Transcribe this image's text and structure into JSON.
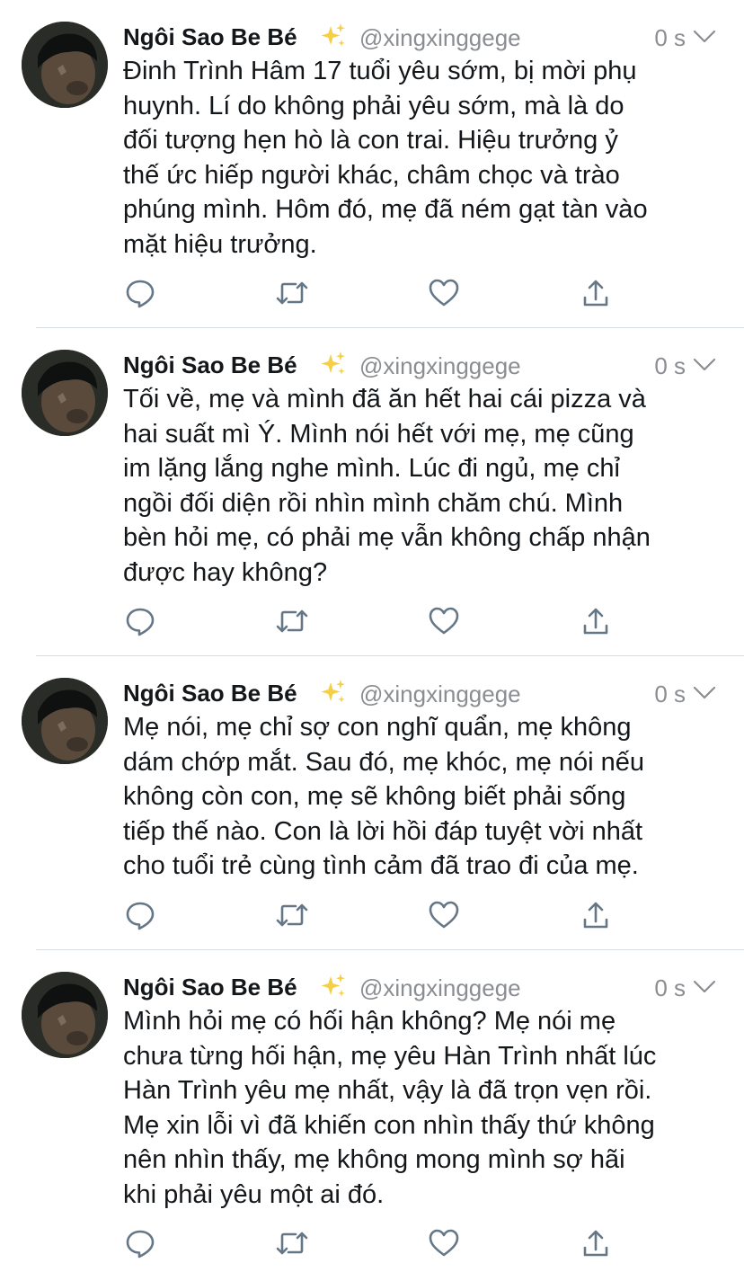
{
  "colors": {
    "text": "#14171a",
    "secondary": "#8a8d91",
    "icon": "#657786",
    "sparkle": "#f5cf45",
    "divider": "#d8dde1"
  },
  "tweets": [
    {
      "name": "Ngôi Sao Be Bé",
      "handle": "@xingxinggege",
      "time": "0 s",
      "text": "Đinh Trình Hâm 17 tuổi yêu sớm, bị mời phụ\nhuynh. Lí do không phải yêu sớm, mà là do\nđối tượng hẹn hò là con trai. Hiệu trưởng ỷ\nthế ức hiếp người khác, châm chọc và trào\nphúng mình. Hôm đó, mẹ đã ném gạt tàn vào\nmặt hiệu trưởng."
    },
    {
      "name": "Ngôi Sao Be Bé",
      "handle": "@xingxinggege",
      "time": "0 s",
      "text": "Tối về, mẹ và mình đã ăn hết hai cái pizza và\nhai suất mì Ý. Mình nói hết với mẹ, mẹ cũng\nim lặng lắng nghe mình. Lúc đi ngủ, mẹ chỉ\nngồi đối diện rồi nhìn mình chăm chú. Mình\nbèn hỏi mẹ, có phải mẹ vẫn không chấp nhận\nđược hay không?"
    },
    {
      "name": "Ngôi Sao Be Bé",
      "handle": "@xingxinggege",
      "time": "0 s",
      "text": "Mẹ nói, mẹ chỉ sợ con nghĩ quẩn, mẹ không\ndám chớp mắt. Sau đó, mẹ khóc, mẹ nói nếu\nkhông còn con, mẹ sẽ không biết phải sống\ntiếp thế nào. Con là lời hồi đáp tuyệt vời nhất\ncho tuổi trẻ cùng tình cảm đã trao đi của mẹ."
    },
    {
      "name": "Ngôi Sao Be Bé",
      "handle": "@xingxinggege",
      "time": "0 s",
      "text": "Mình hỏi mẹ có hối hận không? Mẹ nói mẹ\nchưa từng hối hận, mẹ yêu Hàn Trình nhất lúc\nHàn Trình yêu mẹ nhất, vậy là đã trọn vẹn rồi.\nMẹ xin lỗi vì đã khiến con nhìn thấy thứ không\nnên nhìn thấy, mẹ không mong mình sợ hãi\nkhi phải yêu một ai đó."
    }
  ],
  "icons": {
    "avatar": "avatar-photo",
    "badge": "sparkles-icon",
    "menu": "chevron-down-icon",
    "actions": [
      "reply-icon",
      "retweet-icon",
      "like-icon",
      "share-icon"
    ]
  }
}
